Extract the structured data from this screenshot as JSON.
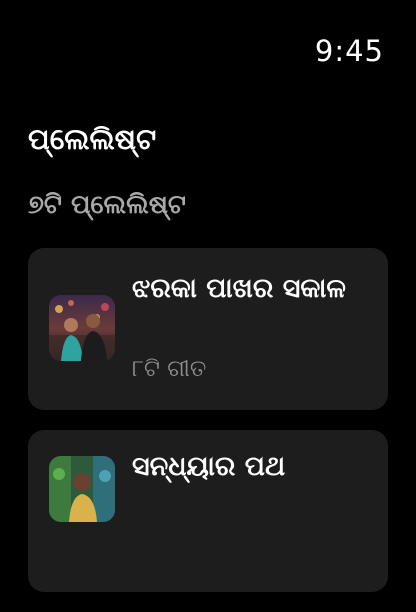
{
  "status": {
    "time": "9:45"
  },
  "header": {
    "title": "ପ୍ଲେଲିଷ୍ଟ",
    "subtitle": "୭ଟି ପ୍ଲେଲିଷ୍ଟ"
  },
  "playlists": [
    {
      "title": "ଝରକା ପାଖର ସକାଳ",
      "count": "୮ଟି ଗୀତ",
      "thumbnail_icon": "couple-street-photo"
    },
    {
      "title": "ସନ୍ଧ୍ୟାର ପଥ",
      "count": "",
      "thumbnail_icon": "woman-garden-photo"
    }
  ],
  "colors": {
    "background": "#000000",
    "card": "#1d1d1d",
    "subtitle": "#a8a8a8",
    "count": "#8e8e8e"
  }
}
